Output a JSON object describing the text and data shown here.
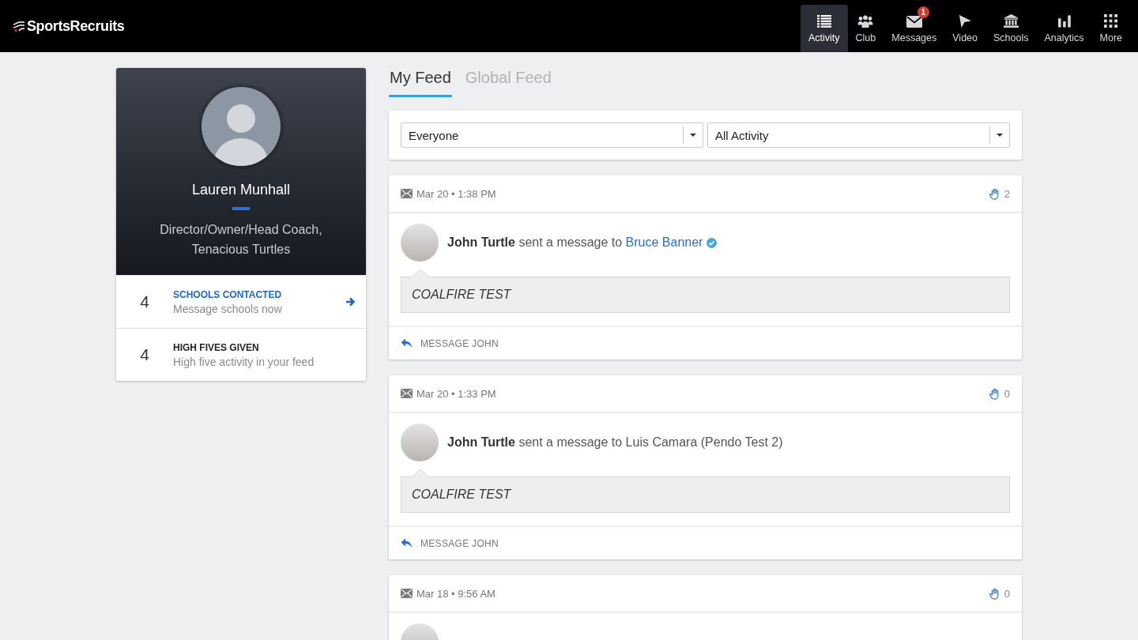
{
  "top_bar": {
    "logo": "SportsRecruits",
    "nav": [
      {
        "label": "Activity",
        "selected": true
      },
      {
        "label": "Club",
        "selected": false
      },
      {
        "label": "Messages",
        "selected": false,
        "badge": "1"
      },
      {
        "label": "Video",
        "selected": false
      },
      {
        "label": "Schools",
        "selected": false
      },
      {
        "label": "Analytics",
        "selected": false
      },
      {
        "label": "More",
        "selected": false
      }
    ]
  },
  "profile": {
    "name": "Lauren Munhall",
    "title": "Director/Owner/Head Coach, Tenacious Turtles",
    "stats": [
      {
        "kind": "link",
        "count": "4",
        "label": "SCHOOLS CONTACTED",
        "subtitle": "Message schools now"
      },
      {
        "kind": "plain",
        "count": "4",
        "label": "HIGH FIVES GIVEN",
        "subtitle": "High five activity in your feed"
      }
    ]
  },
  "feed_tabs": [
    {
      "label": "My Feed",
      "selected": true
    },
    {
      "label": "Global Feed",
      "selected": false
    }
  ],
  "filters": [
    {
      "value": "Everyone"
    },
    {
      "value": "All Activity"
    }
  ],
  "posts": [
    {
      "date": "Mar 20 • 1:38 PM",
      "high_fives": "2",
      "sender": "John Turtle",
      "action": "sent a message to",
      "recipient": "Bruce Banner",
      "recipient_linked": true,
      "verified": true,
      "message": "COALFIRE TEST",
      "reply": "MESSAGE JOHN"
    },
    {
      "date": "Mar 20 • 1:33 PM",
      "high_fives": "0",
      "sender": "John Turtle",
      "action": "sent a message to",
      "recipient": "Luis Camara (Pendo Test 2)",
      "recipient_linked": false,
      "verified": false,
      "message": "COALFIRE TEST",
      "reply": "MESSAGE JOHN"
    },
    {
      "date": "Mar 18 • 9:56 AM",
      "high_fives": "0"
    }
  ]
}
